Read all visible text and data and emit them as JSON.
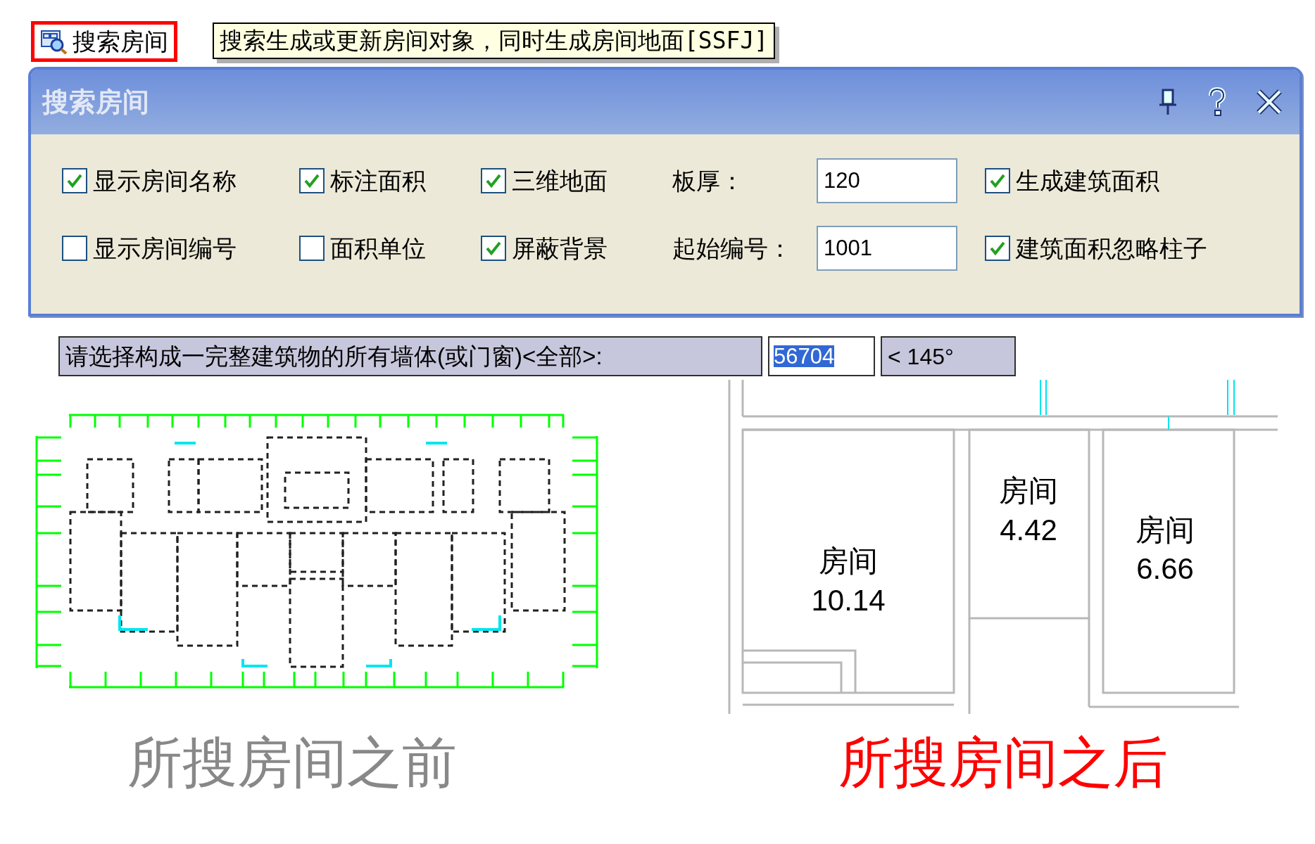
{
  "toolbar_button": {
    "label": "搜索房间"
  },
  "tooltip": {
    "text": "搜索生成或更新房间对象，同时生成房间地面[SSFJ]"
  },
  "dialog": {
    "title": "搜索房间",
    "rows": [
      {
        "items": [
          {
            "kind": "checkbox",
            "label": "显示房间名称",
            "checked": true
          },
          {
            "kind": "checkbox",
            "label": "标注面积",
            "checked": true
          },
          {
            "kind": "checkbox",
            "label": "三维地面",
            "checked": true
          },
          {
            "kind": "field",
            "label": "板厚：",
            "value": "120"
          },
          {
            "kind": "checkbox",
            "label": "生成建筑面积",
            "checked": true
          }
        ]
      },
      {
        "items": [
          {
            "kind": "checkbox",
            "label": "显示房间编号",
            "checked": false
          },
          {
            "kind": "checkbox",
            "label": "面积单位",
            "checked": false
          },
          {
            "kind": "checkbox",
            "label": "屏蔽背景",
            "checked": true
          },
          {
            "kind": "field",
            "label": "起始编号：",
            "value": "1001"
          },
          {
            "kind": "checkbox",
            "label": "建筑面积忽略柱子",
            "checked": true
          }
        ]
      }
    ]
  },
  "command_line": {
    "prompt": "请选择构成一完整建筑物的所有墙体(或门窗)<全部>:",
    "value": "56704",
    "value_selected": true,
    "angle": "< 145°"
  },
  "plan_after": {
    "rooms": [
      {
        "name": "房间",
        "area": "10.14"
      },
      {
        "name": "房间",
        "area": "4.42"
      },
      {
        "name": "房间",
        "area": "6.66"
      }
    ]
  },
  "captions": {
    "before": "所搜房间之前",
    "after": "所搜房间之后"
  }
}
